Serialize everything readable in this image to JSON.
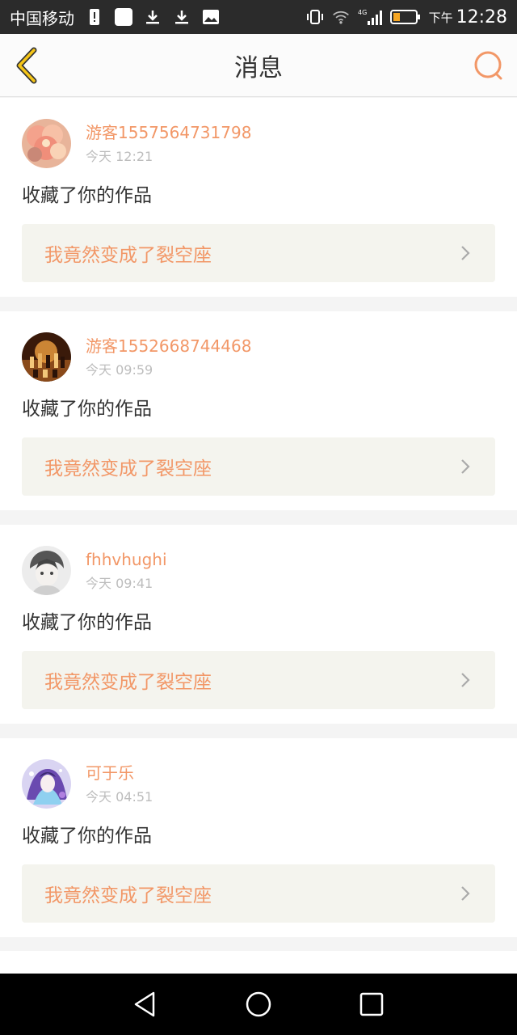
{
  "status_bar": {
    "carrier": "中国移动",
    "network": "4G",
    "ampm": "下午",
    "time": "12:28"
  },
  "header": {
    "title": "消息",
    "accent_color": "#f29767"
  },
  "notifications": [
    {
      "username": "游客1557564731798",
      "time": "今天 12:21",
      "action": "收藏了你的作品",
      "work_title": "我竟然变成了裂空座",
      "avatar": "flower-avatar"
    },
    {
      "username": "游客1552668744468",
      "time": "今天 09:59",
      "action": "收藏了你的作品",
      "work_title": "我竟然变成了裂空座",
      "avatar": "chess-avatar"
    },
    {
      "username": "fhhvhughi",
      "time": "今天 09:41",
      "action": "收藏了你的作品",
      "work_title": "我竟然变成了裂空座",
      "avatar": "anime-boy-avatar"
    },
    {
      "username": "可于乐",
      "time": "今天 04:51",
      "action": "收藏了你的作品",
      "work_title": "我竟然变成了裂空座",
      "avatar": "anime-girl-avatar"
    }
  ],
  "nav": {
    "icons": [
      "back-triangle-icon",
      "home-circle-icon",
      "recents-square-icon"
    ]
  }
}
